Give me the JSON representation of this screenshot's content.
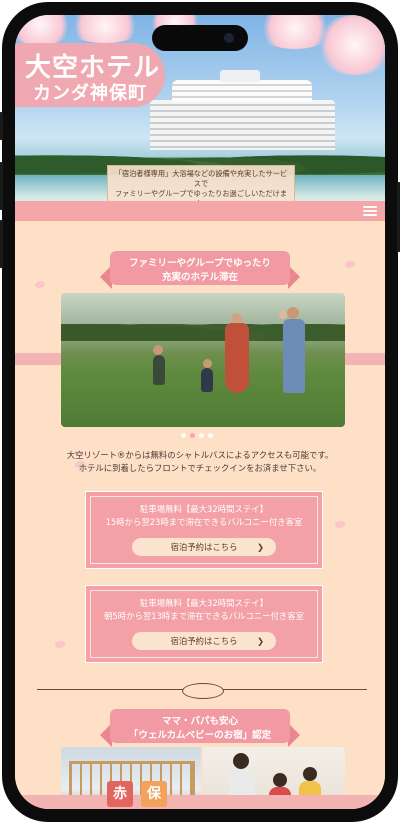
{
  "hero": {
    "logo_line1": "大空ホテル",
    "logo_line2": "カンダ神保町",
    "caption_line1": "「宿泊者様専用」大浴場などの設備や充実したサービスで",
    "caption_line2": "ファミリーやグループでゆったりお過ごしいただけます。"
  },
  "nav": {
    "menu_icon": "hamburger-menu-icon"
  },
  "section1": {
    "ribbon_line1": "ファミリーやグループでゆったり",
    "ribbon_line2": "充実のホテル滞在",
    "carousel_dots": 4,
    "active_dot": 2,
    "desc_line1": "大空リゾート®からは無料のシャトルバスによるアクセスも可能です。",
    "desc_line2": "ホテルに到着したらフロントでチェックインをお済ませ下さい。"
  },
  "plans": [
    {
      "title": "駐車場無料【最大32時間ステイ】",
      "subtitle": "15時から翌23時まで滞在できるバルコニー付き客室",
      "button": "宿泊予約はこちら",
      "chevron": "❯"
    },
    {
      "title": "駐車場無料【最大32時間ステイ】",
      "subtitle": "朝5時から翌13時まで滞在できるバルコニー付き客室",
      "button": "宿泊予約はこちら",
      "chevron": "❯"
    }
  ],
  "section2": {
    "ribbon_line1": "ママ・パパも安心",
    "ribbon_line2": "「ウェルカムベビーのお宿」認定"
  },
  "bottom_tags": [
    "赤",
    "保"
  ],
  "colors": {
    "background": "#fde0c6",
    "accent_pink": "#f4a6a9",
    "card_pink": "#f3a0a6",
    "button_cream": "#fbe4cf",
    "text_brown": "#4a3a34"
  }
}
